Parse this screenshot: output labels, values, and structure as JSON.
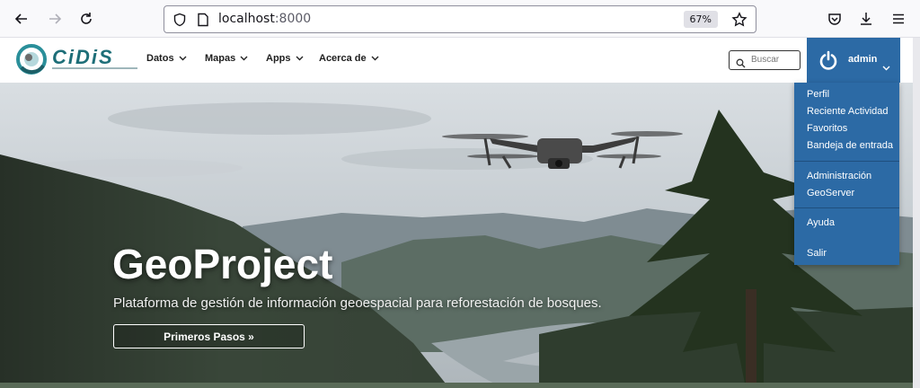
{
  "browser": {
    "url_host": "localhost",
    "url_port": ":8000",
    "zoom": "67%"
  },
  "navbar": {
    "items": [
      {
        "label": "Datos"
      },
      {
        "label": "Mapas"
      },
      {
        "label": "Apps"
      },
      {
        "label": "Acerca de"
      }
    ],
    "search_placeholder": "Buscar",
    "user": "admin"
  },
  "user_menu": {
    "items": [
      {
        "label": "Perfil"
      },
      {
        "label": "Reciente Actividad"
      },
      {
        "label": "Favoritos"
      },
      {
        "label": "Bandeja de entrada"
      },
      {
        "label": "Administración"
      },
      {
        "label": "GeoServer"
      },
      {
        "label": "Ayuda"
      },
      {
        "label": "Salir"
      }
    ]
  },
  "hero": {
    "title": "GeoProject",
    "subtitle": "Plataforma de gestión de información geoespacial para reforestación de bosques.",
    "button": "Primeros Pasos »"
  },
  "colors": {
    "accent": "#2c6aa5",
    "logo_teal": "#2a8f9a"
  }
}
